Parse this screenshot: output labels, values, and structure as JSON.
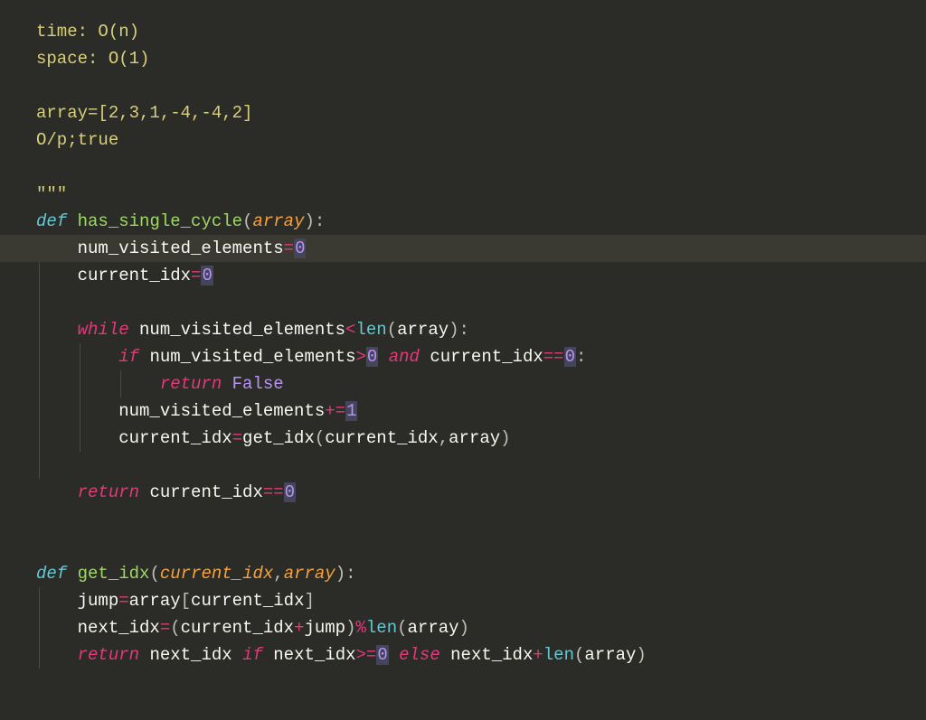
{
  "comment": {
    "line1": "time: O(n)",
    "line2": "space: O(1)",
    "line3": "array=[2,3,1,-4,-4,2]",
    "line4": "O/p;true",
    "end": "\"\"\""
  },
  "tokens": {
    "def": "def",
    "while": "while",
    "if": "if",
    "return": "return",
    "and": "and",
    "else": "else",
    "len": "len",
    "False": "False",
    "has_single_cycle": "has_single_cycle",
    "get_idx": "get_idx",
    "array": "array",
    "current_idx": "current_idx",
    "num_visited_elements": "num_visited_elements",
    "jump": "jump",
    "next_idx": "next_idx",
    "zero": "0",
    "one": "1",
    "eq": "=",
    "eqeq": "==",
    "pluseq": "+=",
    "lt": "<",
    "gt": ">",
    "gte": ">=",
    "plus": "+",
    "mod": "%",
    "lparen": "(",
    "rparen": ")",
    "lbrack": "[",
    "rbrack": "]",
    "colon": ":",
    "comma": ","
  }
}
